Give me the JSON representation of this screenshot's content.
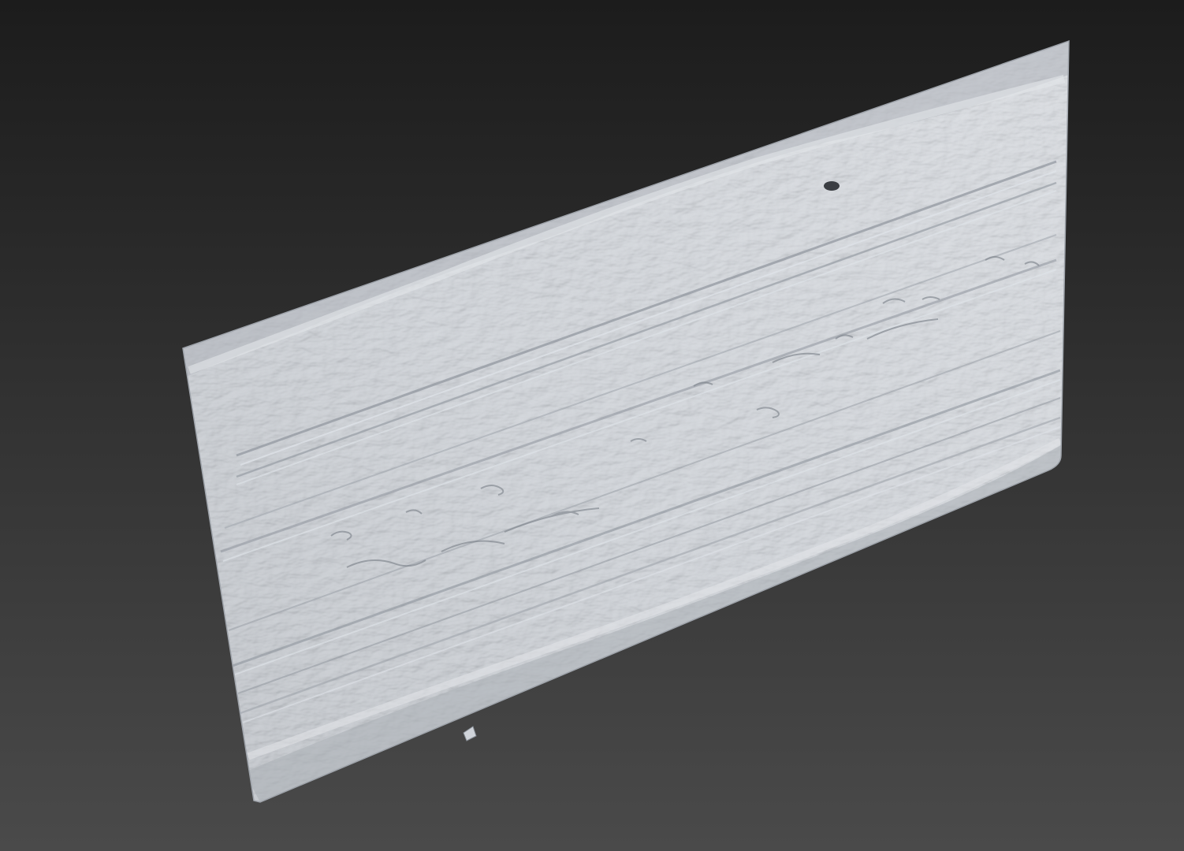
{
  "viewport": {
    "background_top": "#1c1c1c",
    "background_bottom": "#4a4a4a",
    "object": "scanned-terrain-mesh"
  },
  "mesh": {
    "base_color": "#c4c9d0",
    "highlight_color": "#dde1e7",
    "shadow_color": "#7d838b",
    "rut_color": "#9aa0a8"
  }
}
